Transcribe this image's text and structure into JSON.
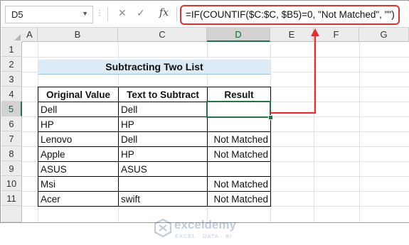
{
  "formula_bar": {
    "name_box": "D5",
    "dots": "⋮",
    "cancel_glyph": "✕",
    "enter_glyph": "✓",
    "fx_label": "fx",
    "formula": "=IF(COUNTIF($C:$C, $B5)=0, \"Not Matched\", \"\")"
  },
  "grid": {
    "columns": [
      "A",
      "B",
      "C",
      "D",
      "E",
      "F",
      "G"
    ],
    "rows": [
      "1",
      "2",
      "3",
      "4",
      "5",
      "6",
      "7",
      "8",
      "9",
      "10",
      "11"
    ],
    "selected_column": "D",
    "selected_row": "5"
  },
  "sheet": {
    "title": "Subtracting Two List",
    "headers": [
      "Original Value",
      "Text to Subtract",
      "Result"
    ],
    "rows": [
      [
        "Dell",
        "Dell",
        ""
      ],
      [
        "HP",
        "HP",
        ""
      ],
      [
        "Lenovo",
        "Dell",
        "Not Matched"
      ],
      [
        "Apple",
        "HP",
        "Not Matched"
      ],
      [
        "ASUS",
        "ASUS",
        ""
      ],
      [
        "Msi",
        "",
        "Not Matched"
      ],
      [
        "Acer",
        "swift",
        "Not Matched"
      ]
    ]
  },
  "watermark": {
    "name": "exceldemy",
    "tagline": "EXCEL · DATA · BI"
  },
  "colors": {
    "formula_highlight": "#e03030",
    "arrow": "#e03030",
    "title_fill": "#ddebf7",
    "excel_green": "#217346"
  },
  "icons": [
    "dropdown-arrow-icon",
    "cancel-icon",
    "enter-icon",
    "function-icon",
    "select-all-icon",
    "annotation-arrow-icon",
    "exceldemy-logo-icon"
  ]
}
